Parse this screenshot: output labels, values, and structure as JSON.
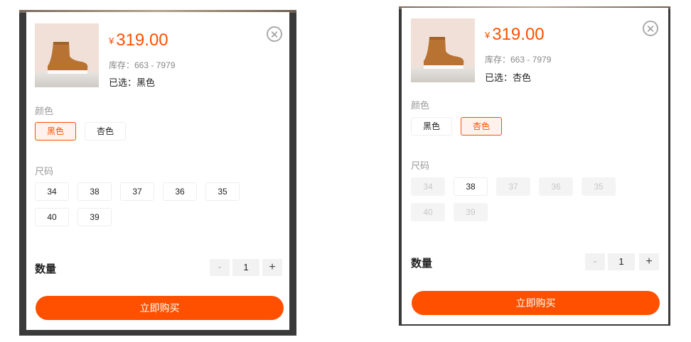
{
  "colors": {
    "accent": "#ff5000",
    "selected_bg": "#fff2ec",
    "disabled_bg": "#f4f4f4"
  },
  "left": {
    "currency": "¥",
    "price": "319.00",
    "stock": "库存：663 - 7979",
    "chosen": "已选：黑色",
    "close_icon": "close-icon",
    "color_label": "颜色",
    "colors": [
      {
        "label": "黑色",
        "state": "selected"
      },
      {
        "label": "杏色",
        "state": "normal"
      }
    ],
    "size_label": "尺码",
    "sizes": [
      "34",
      "38",
      "37",
      "36",
      "35",
      "40",
      "39"
    ],
    "qty_label": "数量",
    "qty_minus": "-",
    "qty_value": "1",
    "qty_plus": "+",
    "buy_label": "立即购买"
  },
  "right": {
    "currency": "¥",
    "price": "319.00",
    "stock": "库存：663 - 7979",
    "chosen": "已选：杏色",
    "close_icon": "close-icon",
    "color_label": "颜色",
    "colors": [
      {
        "label": "黑色",
        "state": "normal"
      },
      {
        "label": "杏色",
        "state": "selected"
      }
    ],
    "size_label": "尺码",
    "sizes": [
      "34",
      "38",
      "37",
      "36",
      "35",
      "40",
      "39"
    ],
    "size_available": [
      "38"
    ],
    "qty_label": "数量",
    "qty_minus": "-",
    "qty_value": "1",
    "qty_plus": "+",
    "buy_label": "立即购买"
  }
}
